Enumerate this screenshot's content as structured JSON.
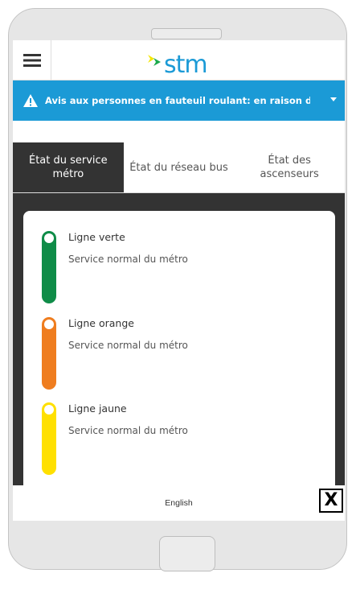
{
  "header": {
    "logo_text": "stm",
    "logo_arrow_colors": [
      "#f3e600",
      "#1aa94b"
    ]
  },
  "alert": {
    "text": "Avis aux personnes en fauteuil roulant: en raison des",
    "background": "#1b9ad6"
  },
  "tabs": [
    {
      "label": "État du service métro",
      "active": true
    },
    {
      "label": "État du réseau bus",
      "active": false
    },
    {
      "label": "État des ascenseurs",
      "active": false
    }
  ],
  "lines": [
    {
      "name": "Ligne verte",
      "status": "Service normal du métro",
      "color": "#0f8c48"
    },
    {
      "name": "Ligne orange",
      "status": "Service normal du métro",
      "color": "#ef7d1f"
    },
    {
      "name": "Ligne jaune",
      "status": "Service normal du métro",
      "color": "#ffe000"
    }
  ],
  "footer": {
    "language_link": "English",
    "close_label": "X"
  }
}
